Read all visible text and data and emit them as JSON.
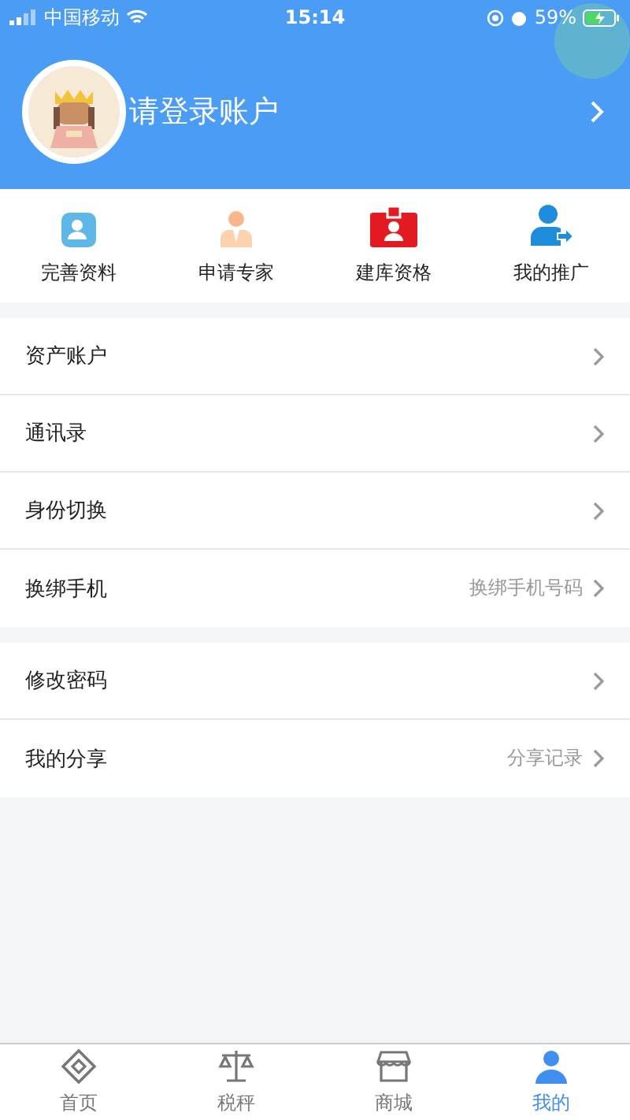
{
  "status_bar": {
    "carrier": "中国移动",
    "time": "15:14",
    "battery": "59%"
  },
  "header": {
    "login_prompt": "请登录账户"
  },
  "quick_actions": [
    {
      "label": "完善资料",
      "kind": "profile"
    },
    {
      "label": "申请专家",
      "kind": "expert"
    },
    {
      "label": "建库资格",
      "kind": "badge"
    },
    {
      "label": "我的推广",
      "kind": "share"
    }
  ],
  "menu_groups": [
    [
      {
        "label": "资产账户"
      },
      {
        "label": "通讯录"
      },
      {
        "label": "身份切换"
      },
      {
        "label": "换绑手机",
        "detail": "换绑手机号码"
      }
    ],
    [
      {
        "label": "修改密码"
      },
      {
        "label": "我的分享",
        "detail": "分享记录"
      }
    ]
  ],
  "tab_bar": [
    {
      "label": "首页",
      "kind": "home",
      "selected": false
    },
    {
      "label": "税秤",
      "kind": "scale",
      "selected": false
    },
    {
      "label": "商城",
      "kind": "shop",
      "selected": false
    },
    {
      "label": "我的",
      "kind": "user",
      "selected": true
    }
  ]
}
